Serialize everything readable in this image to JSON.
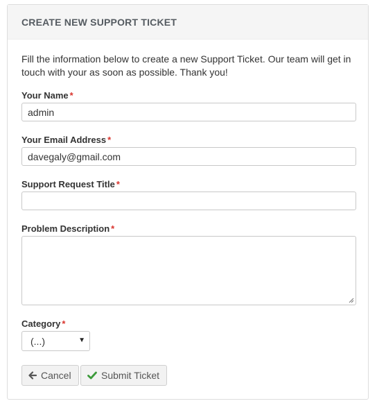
{
  "panel": {
    "title": "CREATE NEW SUPPORT TICKET",
    "intro": "Fill the information below to create a new Support Ticket. Our team will get in touch with your as soon as possible. Thank you!"
  },
  "form": {
    "required_marker": "*",
    "name": {
      "label": "Your Name",
      "value": "admin"
    },
    "email": {
      "label": "Your Email Address",
      "value": "davegaly@gmail.com"
    },
    "title": {
      "label": "Support Request Title",
      "value": ""
    },
    "description": {
      "label": "Problem Description",
      "value": ""
    },
    "category": {
      "label": "Category",
      "selected": "(...)"
    }
  },
  "actions": {
    "cancel_label": "Cancel",
    "submit_label": "Submit Ticket"
  },
  "icons": {
    "cancel": "arrow-left-icon",
    "submit": "checkmark-icon",
    "dropdown": "caret-down-icon"
  },
  "colors": {
    "required": "#d9352e",
    "check": "#3c9a3a",
    "heading_bg": "#f5f5f5"
  }
}
